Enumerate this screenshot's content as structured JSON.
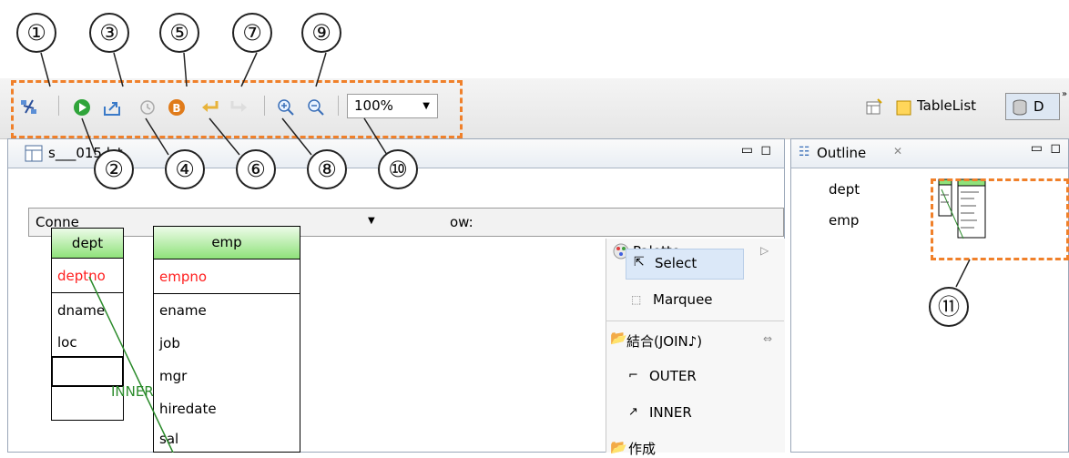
{
  "callouts": [
    "①",
    "②",
    "③",
    "④",
    "⑤",
    "⑥",
    "⑦",
    "⑧",
    "⑨",
    "⑩",
    "⑪"
  ],
  "toolbar": {
    "zoom_value": "100%"
  },
  "right_tabs": {
    "tablelist": "TableList",
    "second": "D"
  },
  "editor": {
    "tab_label": "s___015.lst",
    "connection_label": "Conne",
    "row_label": "ow:",
    "tables": {
      "dept": {
        "title": "dept",
        "rows": [
          "deptno",
          "dname",
          "loc"
        ]
      },
      "emp": {
        "title": "emp",
        "rows": [
          "empno",
          "ename",
          "job",
          "mgr",
          "hiredate",
          "sal"
        ]
      }
    },
    "join_label": "INNER"
  },
  "palette": {
    "title": "Palette",
    "select": "Select",
    "marquee": "Marquee",
    "join_group": "結合(JOIN♪)",
    "outer": "OUTER",
    "inner": "INNER",
    "create_group": "作成"
  },
  "outline": {
    "title": "Outline",
    "items": [
      "dept",
      "emp"
    ]
  },
  "colors": {
    "accent_dash": "#f0802a",
    "pk_red": "#ff2020",
    "join_line": "#2a8a2a",
    "header_green": "#8fe27a"
  }
}
